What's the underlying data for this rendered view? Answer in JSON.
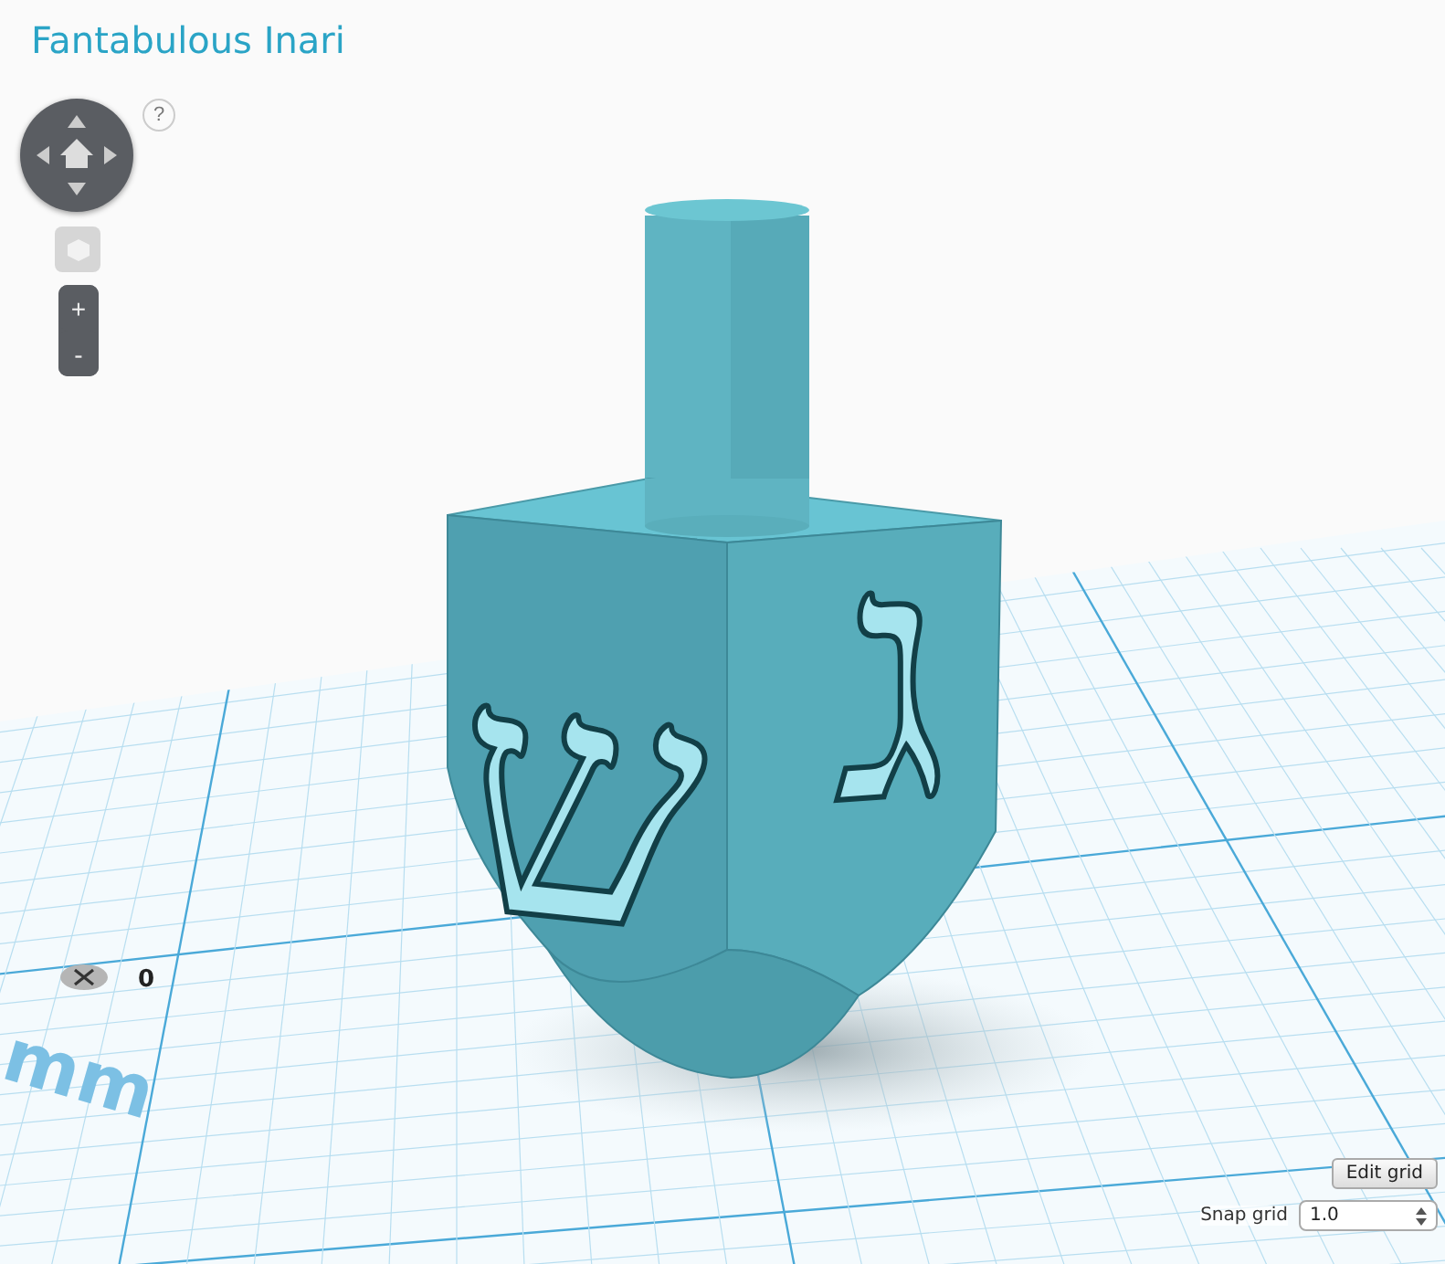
{
  "title": "Fantabulous Inari",
  "help": "?",
  "zoom": {
    "in": "+",
    "out": "-"
  },
  "workplane": {
    "unit": "mm",
    "origin": "0"
  },
  "model": {
    "letters": [
      "ש",
      "ג"
    ]
  },
  "grid_controls": {
    "edit_button": "Edit grid",
    "snap_label": "Snap grid",
    "snap_value": "1.0"
  }
}
